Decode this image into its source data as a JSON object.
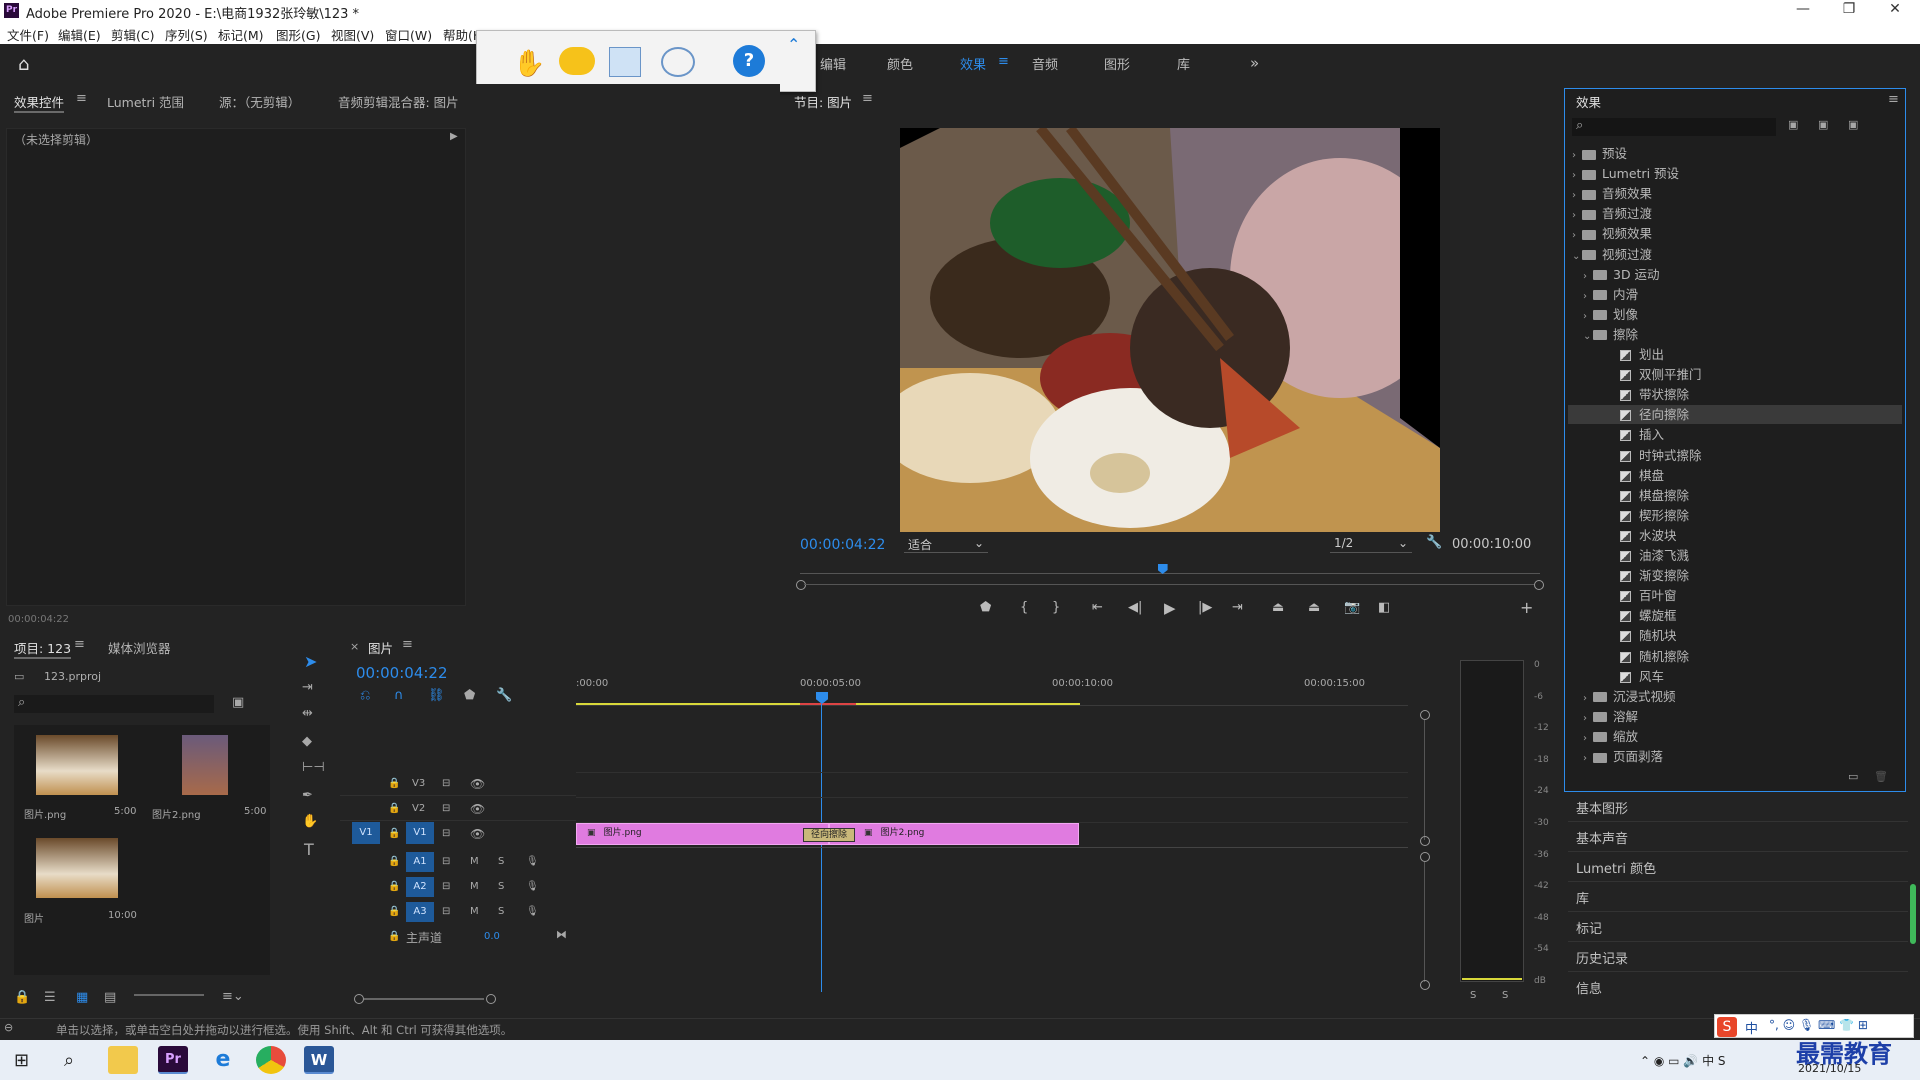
{
  "app": {
    "title": "Adobe Premiere Pro 2020 - E:\\电商1932张玲敏\\123 *",
    "logo": "Pr"
  },
  "window_controls": [
    "—",
    "❐",
    "✕"
  ],
  "menu": [
    "文件(F)",
    "编辑(E)",
    "剪辑(C)",
    "序列(S)",
    "标记(M)",
    "图形(G)",
    "视图(V)",
    "窗口(W)",
    "帮助(H)"
  ],
  "workspaces": {
    "items": [
      "编辑",
      "颜色",
      "效果",
      "音频",
      "图形",
      "库"
    ],
    "active": "效果",
    "more": "»"
  },
  "source_panel": {
    "tabs": [
      "效果控件",
      "Lumetri 范围",
      "源：（无剪辑）",
      "音频剪辑混合器: 图片"
    ],
    "no_clip": "（未选择剪辑）",
    "timecode": "00:00:04:22"
  },
  "program": {
    "title": "节目: 图片",
    "timecode": "00:00:04:22",
    "fit": "适合",
    "resolution": "1/2",
    "duration": "00:00:10:00",
    "playhead_fraction": 0.49
  },
  "project": {
    "tabs": [
      "项目: 123",
      "媒体浏览器"
    ],
    "file": "123.prproj",
    "items": [
      {
        "name": "图片.png",
        "dur": "5:00"
      },
      {
        "name": "图片2.png",
        "dur": "5:00"
      },
      {
        "name": "图片",
        "dur": "10:00"
      }
    ]
  },
  "timeline": {
    "tab": "图片",
    "timecode": "00:00:04:22",
    "ruler": [
      ":00:00",
      "00:00:05:00",
      "00:00:10:00",
      "00:00:15:00"
    ],
    "tracks_v": [
      "V3",
      "V2",
      "V1"
    ],
    "tracks_a": [
      "A1",
      "A2",
      "A3"
    ],
    "src_label": "V1",
    "master": "主声道",
    "master_val": "0.0",
    "clips": [
      {
        "name": "图片.png"
      },
      {
        "name": "图片2.png"
      }
    ],
    "transition": "径向擦除",
    "clip_color": "#e07be0"
  },
  "effects": {
    "title": "效果",
    "tree": [
      {
        "label": "预设",
        "level": 0,
        "type": "folder",
        "open": false
      },
      {
        "label": "Lumetri 预设",
        "level": 0,
        "type": "folder",
        "open": false
      },
      {
        "label": "音频效果",
        "level": 0,
        "type": "folder",
        "open": false
      },
      {
        "label": "音频过渡",
        "level": 0,
        "type": "folder",
        "open": false
      },
      {
        "label": "视频效果",
        "level": 0,
        "type": "folder",
        "open": false
      },
      {
        "label": "视频过渡",
        "level": 0,
        "type": "folder",
        "open": true
      },
      {
        "label": "3D 运动",
        "level": 1,
        "type": "folder",
        "open": false
      },
      {
        "label": "内滑",
        "level": 1,
        "type": "folder",
        "open": false
      },
      {
        "label": "划像",
        "level": 1,
        "type": "folder",
        "open": false
      },
      {
        "label": "擦除",
        "level": 1,
        "type": "folder",
        "open": true
      },
      {
        "label": "划出",
        "level": 2,
        "type": "fx"
      },
      {
        "label": "双侧平推门",
        "level": 2,
        "type": "fx"
      },
      {
        "label": "带状擦除",
        "level": 2,
        "type": "fx"
      },
      {
        "label": "径向擦除",
        "level": 2,
        "type": "fx",
        "selected": true
      },
      {
        "label": "插入",
        "level": 2,
        "type": "fx"
      },
      {
        "label": "时钟式擦除",
        "level": 2,
        "type": "fx"
      },
      {
        "label": "棋盘",
        "level": 2,
        "type": "fx"
      },
      {
        "label": "棋盘擦除",
        "level": 2,
        "type": "fx"
      },
      {
        "label": "楔形擦除",
        "level": 2,
        "type": "fx"
      },
      {
        "label": "水波块",
        "level": 2,
        "type": "fx"
      },
      {
        "label": "油漆飞溅",
        "level": 2,
        "type": "fx"
      },
      {
        "label": "渐变擦除",
        "level": 2,
        "type": "fx"
      },
      {
        "label": "百叶窗",
        "level": 2,
        "type": "fx"
      },
      {
        "label": "螺旋框",
        "level": 2,
        "type": "fx"
      },
      {
        "label": "随机块",
        "level": 2,
        "type": "fx"
      },
      {
        "label": "随机擦除",
        "level": 2,
        "type": "fx"
      },
      {
        "label": "风车",
        "level": 2,
        "type": "fx"
      },
      {
        "label": "沉浸式视频",
        "level": 1,
        "type": "folder",
        "open": false
      },
      {
        "label": "溶解",
        "level": 1,
        "type": "folder",
        "open": false
      },
      {
        "label": "缩放",
        "level": 1,
        "type": "folder",
        "open": false
      },
      {
        "label": "页面剥落",
        "level": 1,
        "type": "folder",
        "open": false
      }
    ]
  },
  "side_sections": [
    "基本图形",
    "基本声音",
    "Lumetri 颜色",
    "库",
    "标记",
    "历史记录",
    "信息"
  ],
  "audio_meter": {
    "scale": [
      "0",
      "-6",
      "-12",
      "-18",
      "-24",
      "-30",
      "-36",
      "-42",
      "-48",
      "-54",
      "dB"
    ],
    "solo": [
      "S",
      "S"
    ]
  },
  "status": "单击以选择，或单击空白处并拖动以进行框选。使用 Shift、Alt 和 Ctrl 可获得其他选项。",
  "tray": {
    "date": "2021/10/15",
    "brand": "最需教育",
    "ime": "中"
  }
}
